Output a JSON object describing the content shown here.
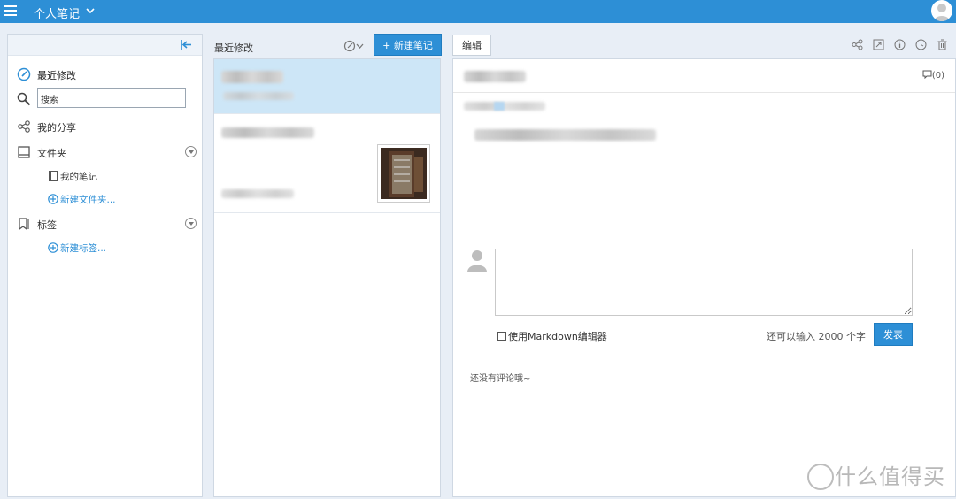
{
  "topbar": {
    "title": "个人笔记"
  },
  "sidebar": {
    "recent_label": "最近修改",
    "search_placeholder": "搜索",
    "share_label": "我的分享",
    "folders_label": "文件夹",
    "my_notes_label": "我的笔记",
    "new_folder_label": "新建文件夹...",
    "tags_label": "标签",
    "new_tag_label": "新建标签..."
  },
  "notes_list": {
    "header_title": "最近修改",
    "new_note_label": "+ 新建笔记"
  },
  "editor": {
    "edit_label": "编辑",
    "comment_count": "(0)",
    "markdown_label": "使用Markdown编辑器",
    "remaining_text": "还可以输入 2000 个字",
    "publish_label": "发表",
    "no_comment_text": "还没有评论哦~"
  },
  "watermark": {
    "text": "什么值得买"
  },
  "colors": {
    "accent": "#2d8fd6",
    "selected_row": "#cde6f7"
  }
}
